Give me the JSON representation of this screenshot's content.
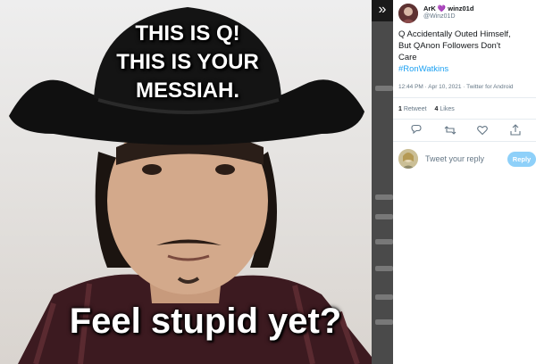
{
  "viewer": {
    "collapse_glyph": "»",
    "meme_top_lines": [
      "THIS IS Q!",
      "THIS IS YOUR",
      "MESSIAH."
    ],
    "meme_bottom": "Feel stupid yet?"
  },
  "tweet": {
    "author_name": "ArK 💜 winz01d",
    "author_handle": "@Winz01D",
    "text_lines": [
      "Q Accidentally Outed Himself,",
      "But QAnon Followers Don't",
      "Care"
    ],
    "hashtag": "#RonWatkins",
    "meta": "12:44 PM · Apr 10, 2021 · Twitter for Android",
    "retweets": {
      "count": "1",
      "label": "Retweet"
    },
    "likes": {
      "count": "4",
      "label": "Likes"
    },
    "actions": [
      "reply-icon",
      "retweet-icon",
      "like-icon",
      "share-icon"
    ],
    "reply_placeholder": "Tweet your reply",
    "reply_button": "Reply"
  },
  "colors": {
    "accent": "#1da1f2",
    "reply_button_disabled": "#8ed0f9",
    "secondary_text": "#657786",
    "primary_text": "#14171a"
  }
}
